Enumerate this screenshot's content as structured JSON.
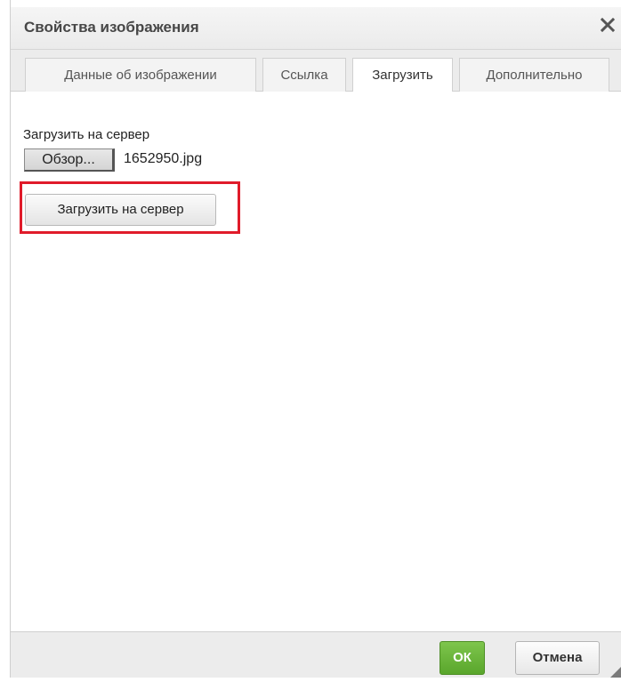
{
  "dialog": {
    "title": "Свойства изображения",
    "close_glyph": "✕"
  },
  "tabs": [
    {
      "label": "Данные об изображении",
      "active": false
    },
    {
      "label": "Ссылка",
      "active": false
    },
    {
      "label": "Загрузить",
      "active": true
    },
    {
      "label": "Дополнительно",
      "active": false
    }
  ],
  "upload": {
    "field_label": "Загрузить на сервер",
    "browse_label": "Обзор...",
    "file_name": "1652950.jpg",
    "send_button_label": "Загрузить на сервер"
  },
  "footer": {
    "ok_label": "ОК",
    "cancel_label": "Отмена"
  },
  "colors": {
    "ok_green": "#65b036",
    "highlight_red": "#e01b2a"
  },
  "icons": {
    "close": "close-icon",
    "resize": "resize-grip-icon"
  }
}
